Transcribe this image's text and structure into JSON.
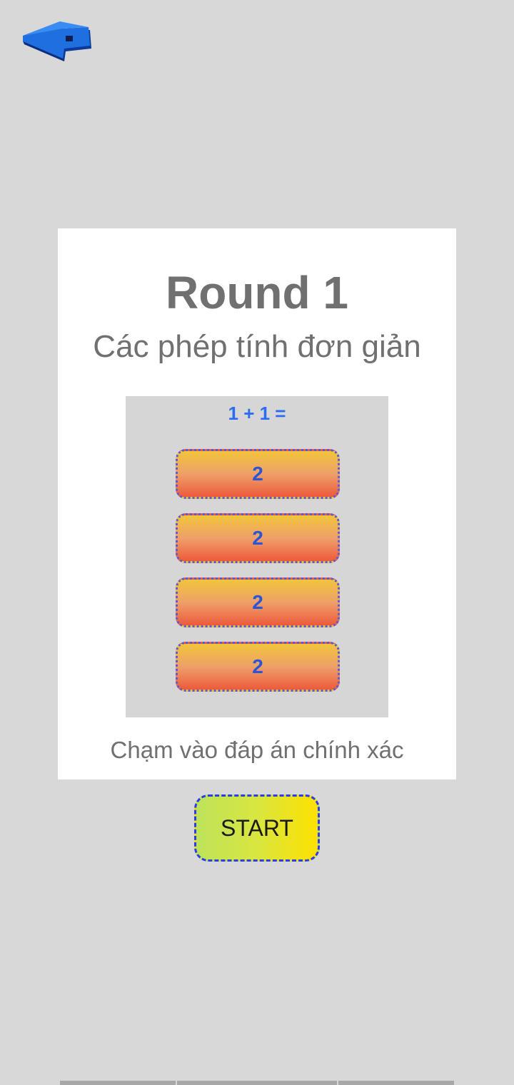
{
  "navigation": {
    "back_icon": "back-arrow-icon"
  },
  "round": {
    "title": "Round 1",
    "subtitle": "Các phép tính đơn giản"
  },
  "preview": {
    "question": "1 + 1 =",
    "answers": [
      "2",
      "2",
      "2",
      "2"
    ]
  },
  "instruction": "Chạm vào đáp án chính xác",
  "start_button": {
    "label": "START"
  },
  "colors": {
    "background": "#d8d8d8",
    "card": "#ffffff",
    "title_text": "#707070",
    "question_text": "#2a6cf2",
    "answer_border": "#5a5ad8",
    "start_border": "#2a3cf0"
  }
}
